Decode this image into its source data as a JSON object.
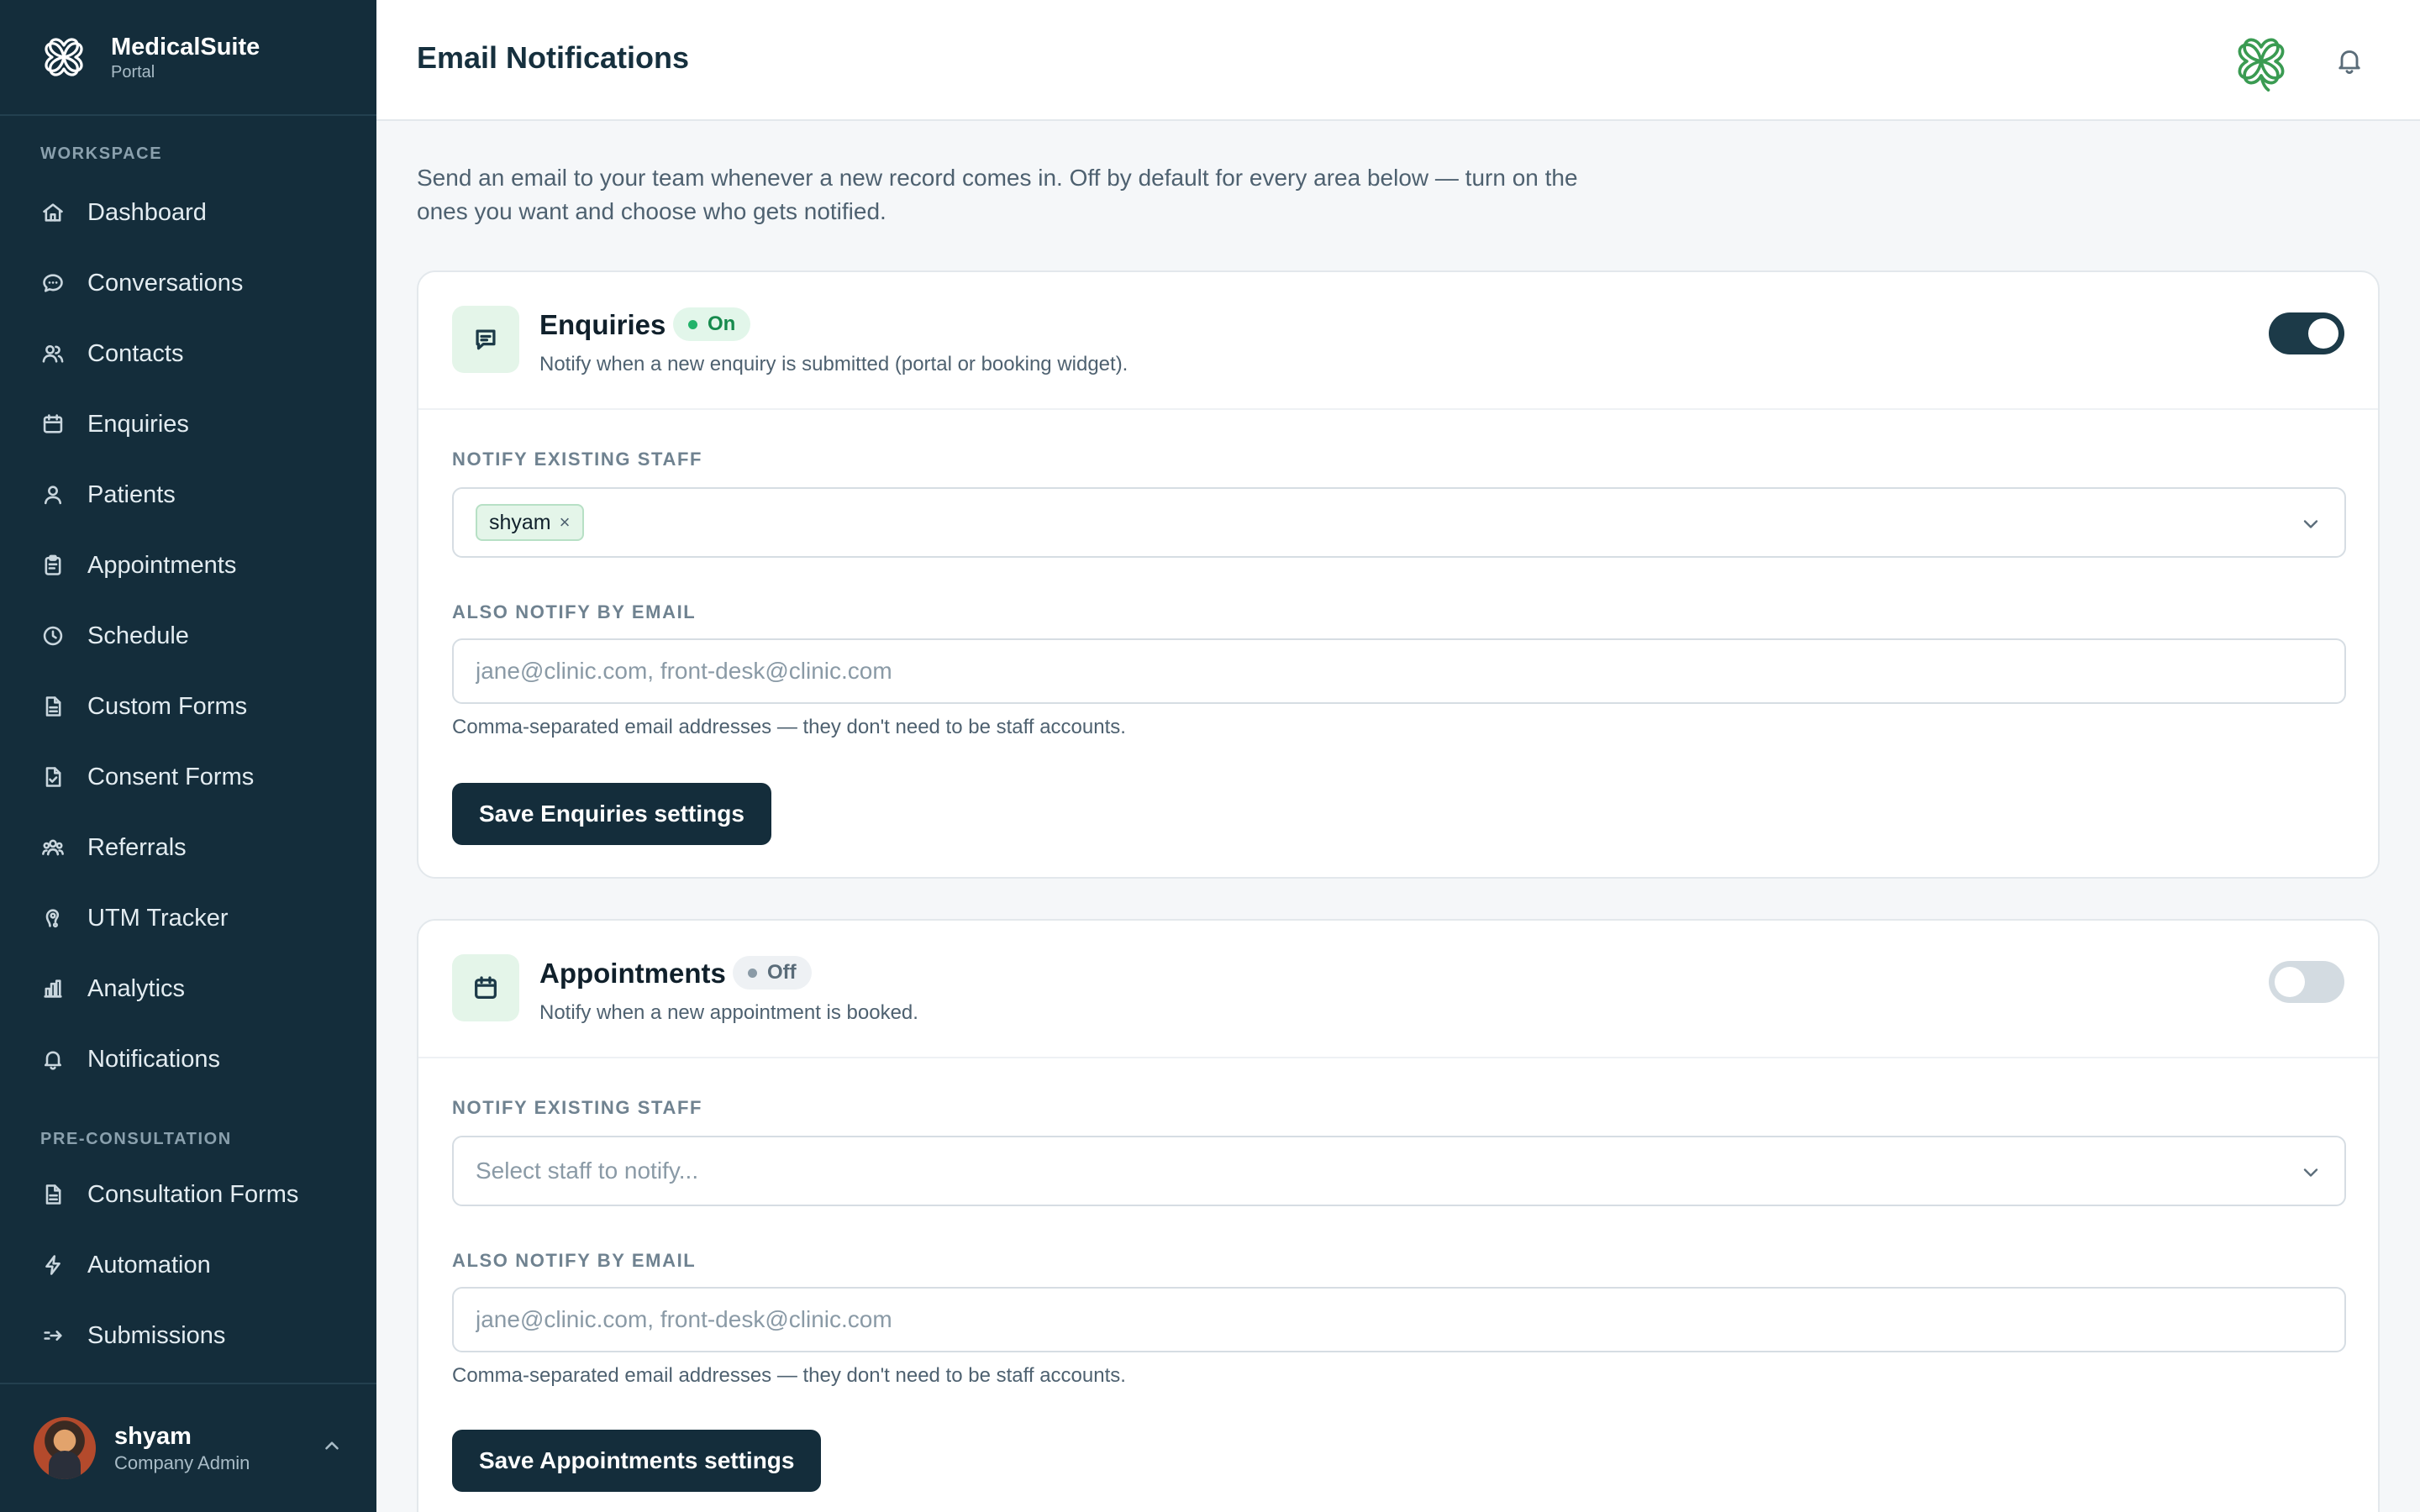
{
  "brand": {
    "name": "MedicalSuite",
    "sub": "Portal"
  },
  "sidebar": {
    "workspace_label": "WORKSPACE",
    "items": [
      {
        "label": "Dashboard",
        "icon": "home-icon"
      },
      {
        "label": "Conversations",
        "icon": "chat-bubble-icon"
      },
      {
        "label": "Contacts",
        "icon": "users-icon"
      },
      {
        "label": "Enquiries",
        "icon": "calendar-icon"
      },
      {
        "label": "Patients",
        "icon": "user-icon"
      },
      {
        "label": "Appointments",
        "icon": "clipboard-icon"
      },
      {
        "label": "Schedule",
        "icon": "clock-icon"
      },
      {
        "label": "Custom Forms",
        "icon": "document-icon"
      },
      {
        "label": "Consent Forms",
        "icon": "document-check-icon"
      },
      {
        "label": "Referrals",
        "icon": "user-group-icon"
      },
      {
        "label": "UTM Tracker",
        "icon": "tracker-icon"
      },
      {
        "label": "Analytics",
        "icon": "bar-chart-icon"
      },
      {
        "label": "Notifications",
        "icon": "bell-icon"
      }
    ],
    "preconsult_label": "PRE-CONSULTATION",
    "pre_items": [
      {
        "label": "Consultation Forms",
        "icon": "document-icon"
      },
      {
        "label": "Automation",
        "icon": "lightning-icon"
      },
      {
        "label": "Submissions",
        "icon": "send-icon"
      }
    ]
  },
  "user": {
    "name": "shyam",
    "role": "Company Admin"
  },
  "header": {
    "title": "Email Notifications"
  },
  "intro": "Send an email to your team whenever a new record comes in. Off by default for every area below — turn on the ones you want and choose who gets notified.",
  "cards": [
    {
      "title": "Enquiries",
      "status": "On",
      "enabled": true,
      "description": "Notify when a new enquiry is submitted (portal or booking widget).",
      "staff_label": "NOTIFY EXISTING STAFF",
      "selected_staff": [
        "shyam"
      ],
      "staff_placeholder": "Select staff to notify...",
      "email_label": "ALSO NOTIFY BY EMAIL",
      "email_value": "",
      "email_placeholder": "jane@clinic.com, front-desk@clinic.com",
      "help": "Comma-separated email addresses — they don't need to be staff accounts.",
      "save_label": "Save Enquiries settings"
    },
    {
      "title": "Appointments",
      "status": "Off",
      "enabled": false,
      "description": "Notify when a new appointment is booked.",
      "staff_label": "NOTIFY EXISTING STAFF",
      "selected_staff": [],
      "staff_placeholder": "Select staff to notify...",
      "email_label": "ALSO NOTIFY BY EMAIL",
      "email_value": "",
      "email_placeholder": "jane@clinic.com, front-desk@clinic.com",
      "help": "Comma-separated email addresses — they don't need to be staff accounts.",
      "save_label": "Save Appointments settings"
    }
  ],
  "colors": {
    "sidebar_bg": "#142d3b",
    "accent_green": "#22b36a",
    "primary_button": "#142d3b"
  }
}
